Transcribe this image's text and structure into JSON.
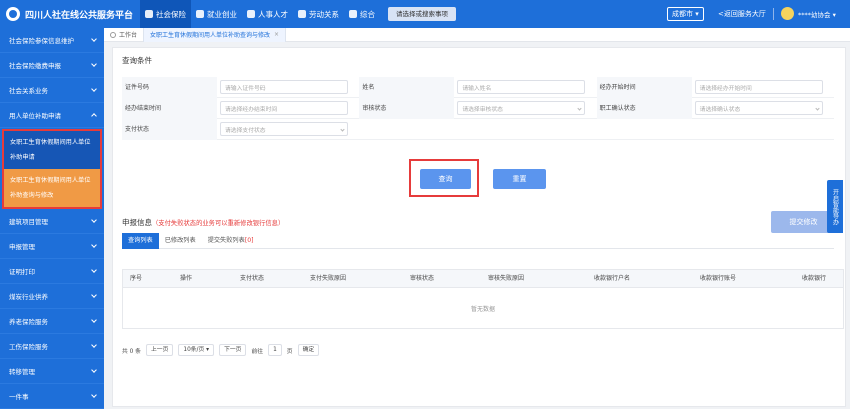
{
  "app": {
    "title": "四川人社在线公共服务平台",
    "nav": [
      "社会保险",
      "就业创业",
      "人事人才",
      "劳动关系",
      "综合"
    ],
    "search_button": "请选择或搜索事项",
    "city": "成都市",
    "back_link": "<返回服务大厅",
    "username": "****幼协会"
  },
  "sidebar": {
    "items_top": [
      "社会保险参保信息维护",
      "社会保险缴费申报",
      "社会关系业务",
      "用人单位补助申请"
    ],
    "sub_items": [
      "女职工生育休假期间用人单位补助申请",
      "女职工生育休假期间用人单位补助查询与修改"
    ],
    "items_bottom": [
      "建筑项目管理",
      "申报管理",
      "证明打印",
      "煤炭行业供养",
      "养老保险服务",
      "工伤保险服务",
      "转移管理",
      "一件事"
    ]
  },
  "tabs": {
    "home": "工作台",
    "current": "女职工生育休假期间用人单位补助查询与修改"
  },
  "query": {
    "section_title": "查询条件",
    "fields": [
      {
        "label": "证件号码",
        "placeholder": "请输入证件号码"
      },
      {
        "label": "姓名",
        "placeholder": "请输入姓名"
      },
      {
        "label": "经办开始时间",
        "placeholder": "请选择经办开始时间"
      },
      {
        "label": "经办结束时间",
        "placeholder": "请选择经办结束时间"
      },
      {
        "label": "审核状态",
        "placeholder": "请选择审核状态"
      },
      {
        "label": "职工确认状态",
        "placeholder": "请选择确认状态"
      },
      {
        "label": "支付状态",
        "placeholder": "请选择支付状态"
      }
    ],
    "query_button": "查询",
    "reset_button": "重置"
  },
  "report": {
    "title": "申报信息",
    "warning": "（支付失败状态的业务可以重新修改银行信息）",
    "submit_button": "提交修改",
    "subtabs": [
      "查询列表",
      "已修改列表",
      "提交失败列表"
    ],
    "fail_count": "[0]",
    "columns": [
      "序号",
      "操作",
      "支付状态",
      "支付失败原因",
      "审核状态",
      "审核失败原因",
      "收款银行户名",
      "收款银行账号",
      "收款银行"
    ],
    "empty_text": "暂无数据"
  },
  "pager": {
    "total": "共 0 条",
    "prev": "上一页",
    "page_size": "10条/页",
    "next": "下一页",
    "goto": "前往",
    "page_value": "1",
    "page_unit": "页",
    "confirm": "确定"
  },
  "float_tab": "开启智能导办",
  "colors": {
    "primary": "#1e6fd9",
    "highlight": "#e63b3b",
    "active_sub": "#f09a45"
  }
}
